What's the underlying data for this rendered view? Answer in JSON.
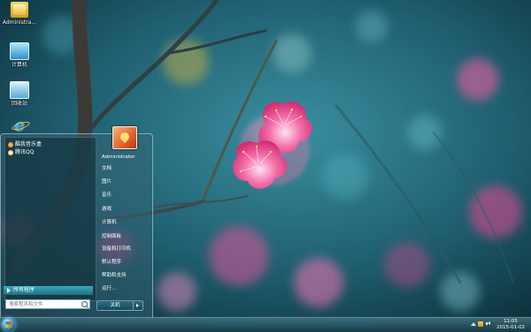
{
  "desktop": {
    "icons": [
      {
        "label": "Administra..."
      },
      {
        "label": "计算机"
      },
      {
        "label": "回收站"
      },
      {
        "label": "Internet Explorer"
      }
    ]
  },
  "start_menu": {
    "pinned": [
      {
        "label": "酷我音乐盒"
      },
      {
        "label": "腾讯QQ"
      }
    ],
    "all_programs": "所有程序",
    "search_placeholder": "搜索程序和文件",
    "user_name": "Administrator",
    "right_items": [
      {
        "label": "文档"
      },
      {
        "label": "图片"
      },
      {
        "label": "音乐"
      },
      {
        "label": "游戏"
      },
      {
        "label": "计算机"
      },
      {
        "label": "控制面板"
      },
      {
        "label": "设备和打印机"
      },
      {
        "label": "默认程序"
      },
      {
        "label": "帮助和支持"
      },
      {
        "label": "运行..."
      }
    ],
    "shutdown_label": "关机"
  },
  "taskbar": {
    "time": "11:05",
    "date": "2015-01-02"
  },
  "colors": {
    "accent": "#1b7182",
    "blossom": "#f0589a"
  }
}
